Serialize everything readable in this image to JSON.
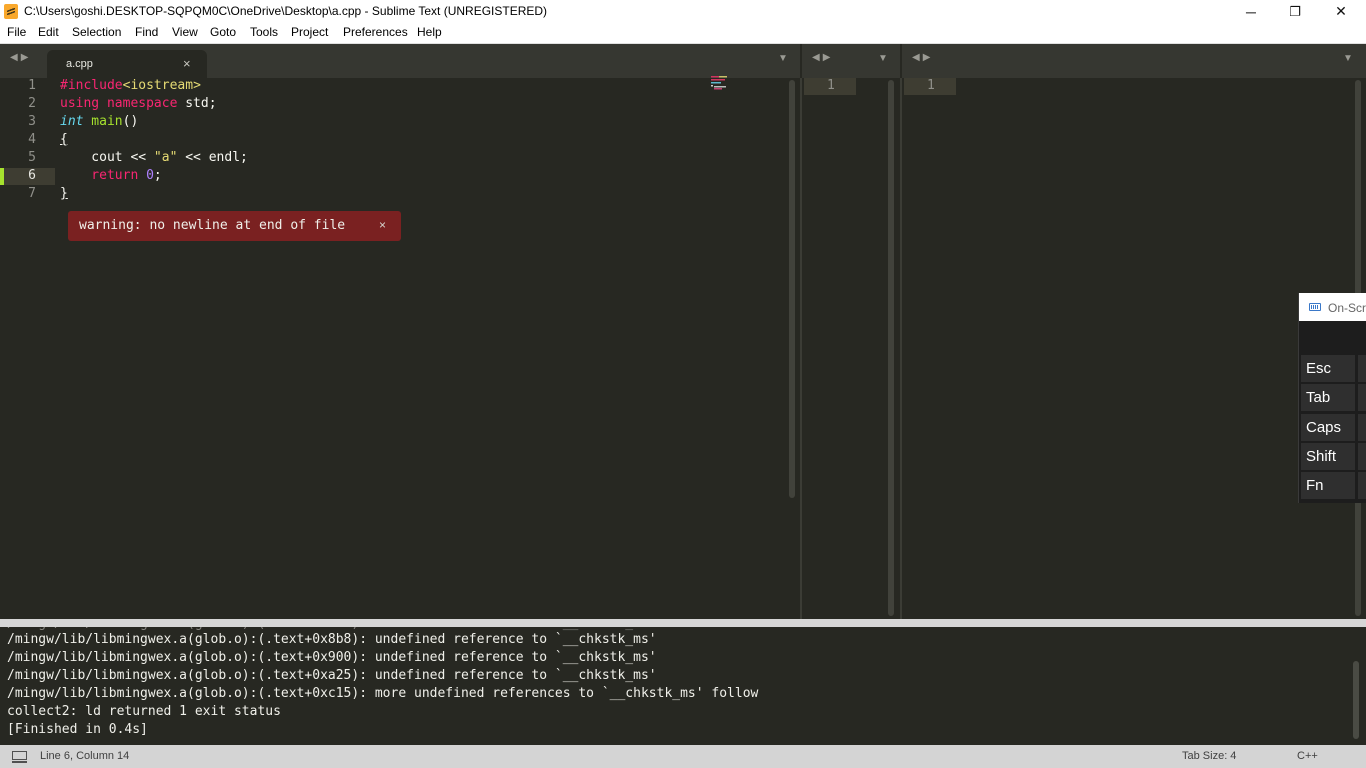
{
  "titlebar": {
    "title": "C:\\Users\\goshi.DESKTOP-SQPQM0C\\OneDrive\\Desktop\\a.cpp - Sublime Text (UNREGISTERED)",
    "app_icon": "sublime-text-icon",
    "minimize": "─",
    "maximize": "❐",
    "close": "✕"
  },
  "menu": [
    "File",
    "Edit",
    "Selection",
    "Find",
    "View",
    "Goto",
    "Tools",
    "Project",
    "Preferences",
    "Help"
  ],
  "tabs": {
    "nav_arrows": "◀▶",
    "dropdown": "▼",
    "active_tab": "a.cpp",
    "close_glyph": "×"
  },
  "editor": {
    "line_numbers": [
      "1",
      "2",
      "3",
      "4",
      "5",
      "6",
      "7"
    ],
    "current_line": 6,
    "warning": {
      "text": "warning: no newline at end of file",
      "close": "×"
    }
  },
  "empty_panes": {
    "pane2_line": "1",
    "pane3_line": "1"
  },
  "osk": {
    "title": "On-Scr",
    "keys": [
      "Esc",
      "Tab",
      "Caps",
      "Shift",
      "Fn"
    ]
  },
  "output": {
    "lines": [
      "/mingw/lib/libmingwex.a(glob.o):(.text+0x8b8): undefined reference to `__chkstk_ms'",
      "/mingw/lib/libmingwex.a(glob.o):(.text+0x900): undefined reference to `__chkstk_ms'",
      "/mingw/lib/libmingwex.a(glob.o):(.text+0xa25): undefined reference to `__chkstk_ms'",
      "/mingw/lib/libmingwex.a(glob.o):(.text+0xc15): more undefined references to `__chkstk_ms' follow",
      "collect2: ld returned 1 exit status",
      "[Finished in 0.4s]"
    ]
  },
  "status": {
    "position": "Line 6, Column 14",
    "tab_size": "Tab Size: 4",
    "syntax": "C++"
  },
  "colors": {
    "editor_bg": "#272822",
    "keyword_pink": "#f92672",
    "keyword_blue": "#66d9ef",
    "function_green": "#a6e22e",
    "string_yellow": "#e6db74",
    "number_purple": "#ae81ff",
    "warning_bg": "#7a2121"
  }
}
